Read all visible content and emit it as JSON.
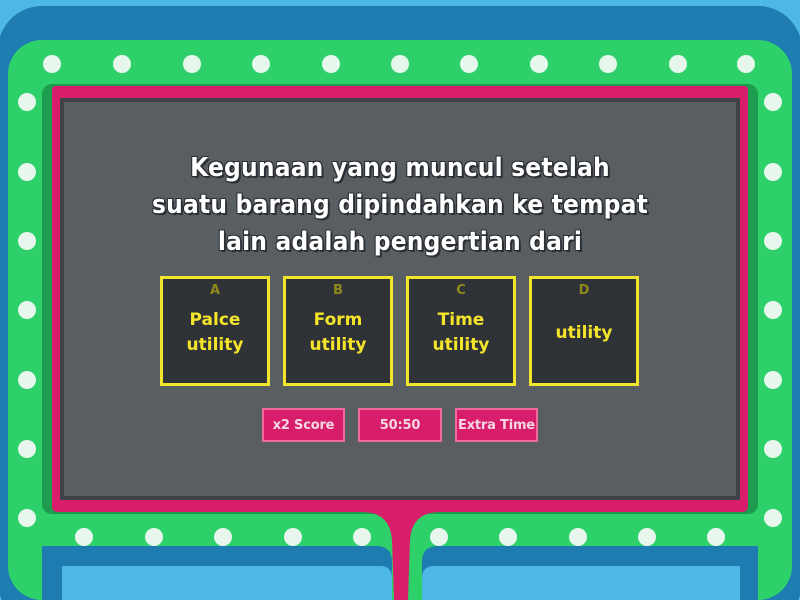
{
  "game": {
    "question": "Kegunaan yang muncul setelah suatu barang dipindahkan ke tempat lain adalah pengertian dari",
    "answers": [
      {
        "letter": "A",
        "text": "Palce utility"
      },
      {
        "letter": "B",
        "text": "Form utility"
      },
      {
        "letter": "C",
        "text": "Time utility"
      },
      {
        "letter": "D",
        "text": "utility"
      }
    ],
    "powerups": {
      "double_score": "x2 Score",
      "fifty_fifty": "50:50",
      "extra_time": "Extra Time"
    }
  },
  "theme": {
    "background": "#4cb8e3",
    "outer_frame": "#1e7cb0",
    "frame_green": "#2ed06a",
    "frame_magenta": "#d81e6a",
    "board": "#595e63",
    "answer_border": "#f2e62a",
    "answer_text": "#f5e52a",
    "bulb": "#e7f7ee"
  }
}
